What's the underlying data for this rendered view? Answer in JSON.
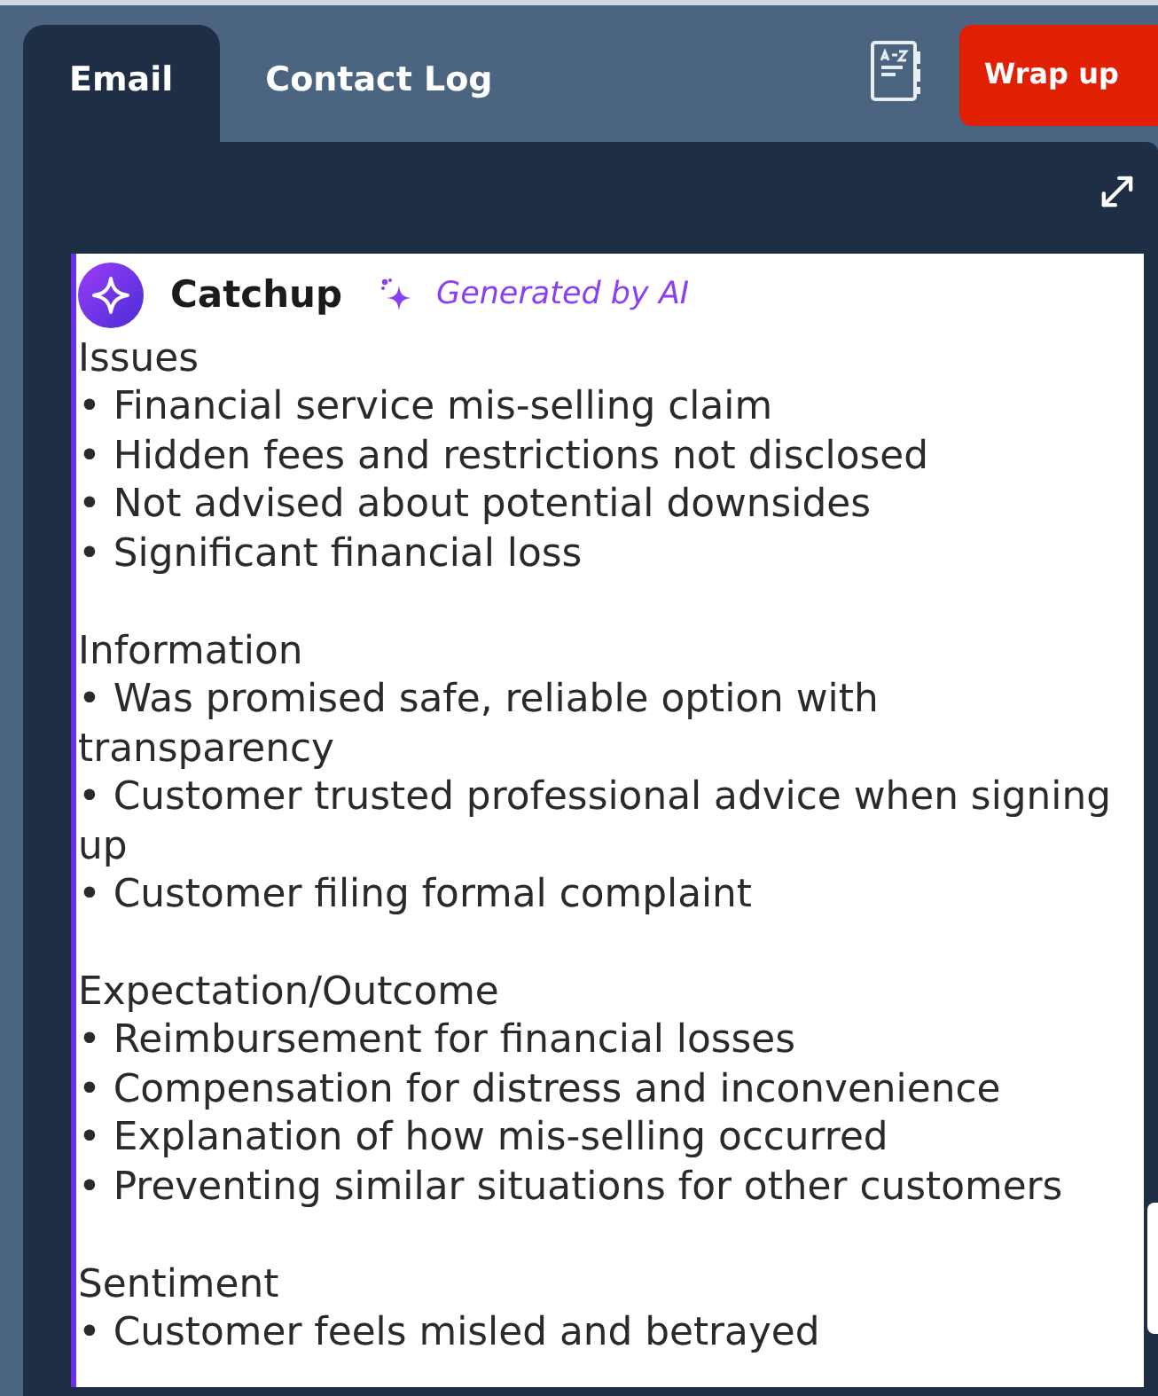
{
  "tabs": [
    {
      "label": "Email",
      "selected": true
    },
    {
      "label": "Contact Log",
      "selected": false
    }
  ],
  "toolbar": {
    "wrap_up_button": "Wrap up"
  },
  "summary": {
    "title": "Catchup",
    "badge": "Generated by AI",
    "sections": [
      {
        "heading": "Issues",
        "items": [
          "• Financial service mis-selling claim",
          "• Hidden fees and restrictions not disclosed",
          "• Not advised about potential downsides",
          "• Significant financial loss"
        ]
      },
      {
        "heading": "Information",
        "items": [
          "• Was promised safe, reliable option with transparency",
          "• Customer trusted professional advice when signing up",
          "• Customer filing formal complaint"
        ]
      },
      {
        "heading": "Expectation/Outcome",
        "items": [
          "• Reimbursement for financial losses",
          "• Compensation for distress and inconvenience",
          "• Explanation of how mis-selling occurred",
          "• Preventing similar situations for other customers"
        ]
      },
      {
        "heading": "Sentiment",
        "items": [
          "• Customer feels misled and betrayed"
        ]
      }
    ]
  }
}
